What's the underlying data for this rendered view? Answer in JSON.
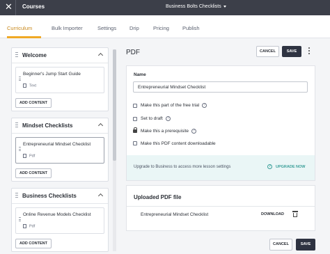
{
  "topbar": {
    "title": "Courses",
    "course_selector": "Business Bolts Checklists"
  },
  "tabs": [
    "Curriculum",
    "Bulk Importer",
    "Settings",
    "Drip",
    "Pricing",
    "Publish"
  ],
  "active_tab": "Curriculum",
  "sidebar": {
    "sections": [
      {
        "title": "Welcome",
        "lessons": [
          {
            "name": "Beginner's Jump Start Guide",
            "type": "Text"
          }
        ],
        "add_label": "ADD CONTENT"
      },
      {
        "title": "Mindset Checklists",
        "lessons": [
          {
            "name": "Entrepreneurial Mindset Checklist",
            "type": "Pdf",
            "selected": true
          }
        ],
        "add_label": "ADD CONTENT"
      },
      {
        "title": "Business Checklists",
        "lessons": [
          {
            "name": "Online Revenue Models Checklist",
            "type": "Pdf"
          }
        ],
        "add_label": "ADD CONTENT"
      }
    ]
  },
  "editor": {
    "heading": "PDF",
    "cancel_label": "CANCEL",
    "save_label": "SAVE",
    "name_label": "Name",
    "name_value": "Entrepreneurial Mindset Checklist",
    "options": {
      "free_trial": "Make this part of the free trial",
      "draft": "Set to draft",
      "prerequisite": "Make this a prerequisite",
      "downloadable": "Make this PDF content downloadable"
    },
    "upgrade_text": "Upgrade to Business to access more lesson settings",
    "upgrade_button": "UPGRADE NOW",
    "uploaded_heading": "Uploaded PDF file",
    "uploaded_filename": "Entrepreneurial Mindset Checklist",
    "download_label": "DOWNLOAD"
  },
  "icons": {
    "close": "close-icon",
    "caret": "caret-down-icon",
    "kebab": "more-vertical-icon",
    "help": "help-circle-icon",
    "lock": "lock-icon",
    "trash": "trash-icon",
    "document": "document-icon",
    "drag": "drag-handle-icon"
  },
  "colors": {
    "accent": "#f0a926",
    "topbar": "#3c3f49",
    "primary_button": "#2e3341",
    "upgrade_bg": "#eaf6f6",
    "upgrade_link": "#3a9f99"
  }
}
